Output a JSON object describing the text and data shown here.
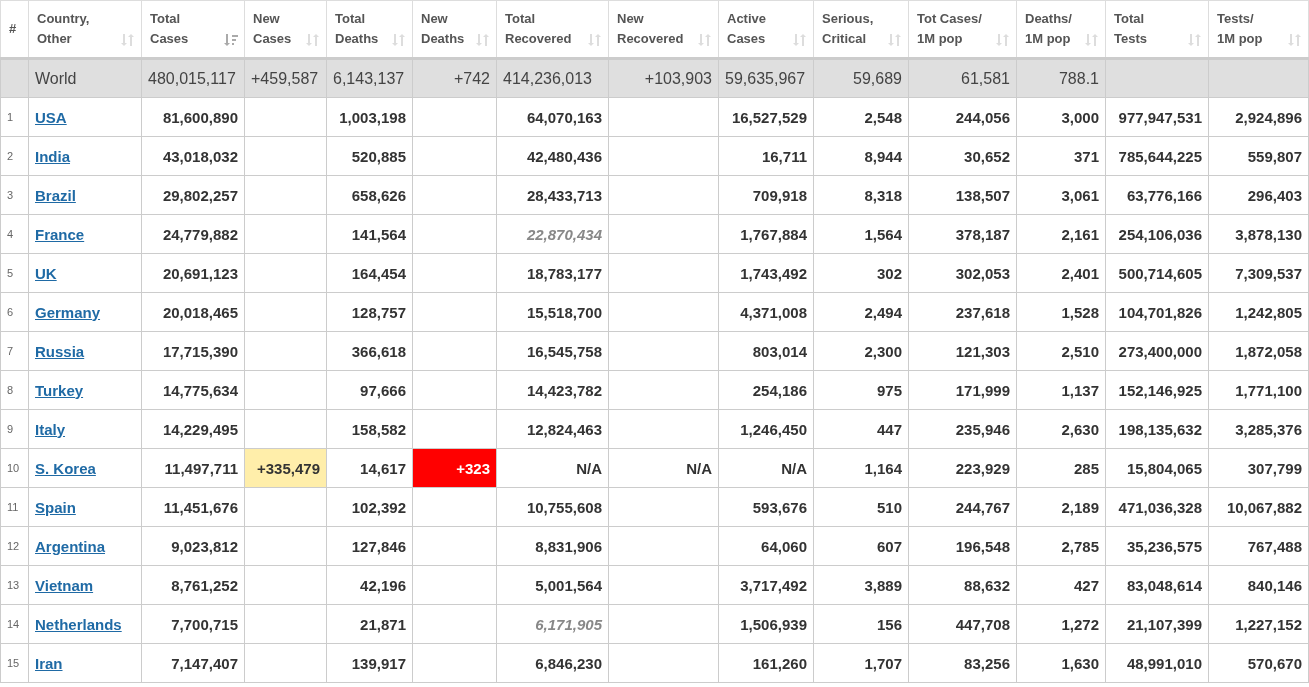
{
  "table": {
    "columns": [
      {
        "label": "#",
        "kind": "rank"
      },
      {
        "label": "Country,\nOther",
        "kind": "country",
        "sorted": false
      },
      {
        "label": "Total\nCases",
        "kind": "number",
        "sorted": true
      },
      {
        "label": "New\nCases",
        "kind": "new_cases",
        "sorted": false
      },
      {
        "label": "Total\nDeaths",
        "kind": "number",
        "sorted": false
      },
      {
        "label": "New\nDeaths",
        "kind": "new_deaths",
        "sorted": false
      },
      {
        "label": "Total\nRecovered",
        "kind": "recovered",
        "sorted": false
      },
      {
        "label": "New\nRecovered",
        "kind": "new_recovered",
        "sorted": false
      },
      {
        "label": "Active\nCases",
        "kind": "number",
        "sorted": false
      },
      {
        "label": "Serious,\nCritical",
        "kind": "number",
        "sorted": false
      },
      {
        "label": "Tot Cases/\n1M pop",
        "kind": "number",
        "sorted": false
      },
      {
        "label": "Deaths/\n1M pop",
        "kind": "number",
        "sorted": false
      },
      {
        "label": "Total\nTests",
        "kind": "number",
        "sorted": false
      },
      {
        "label": "Tests/\n1M pop",
        "kind": "number",
        "sorted": false
      }
    ],
    "rows": [
      {
        "kind": "world",
        "estimated_recovered": false,
        "cells": [
          null,
          "World",
          "480,015,117",
          "+459,587",
          "6,143,137",
          "+742",
          "414,236,013",
          "+103,903",
          "59,635,967",
          "59,689",
          "61,581",
          "788.1",
          null,
          null
        ]
      },
      {
        "kind": "country",
        "estimated_recovered": false,
        "cells": [
          "1",
          "USA",
          "81,600,890",
          null,
          "1,003,198",
          null,
          "64,070,163",
          null,
          "16,527,529",
          "2,548",
          "244,056",
          "3,000",
          "977,947,531",
          "2,924,896"
        ]
      },
      {
        "kind": "country",
        "estimated_recovered": false,
        "cells": [
          "2",
          "India",
          "43,018,032",
          null,
          "520,885",
          null,
          "42,480,436",
          null,
          "16,711",
          "8,944",
          "30,652",
          "371",
          "785,644,225",
          "559,807"
        ]
      },
      {
        "kind": "country",
        "estimated_recovered": false,
        "cells": [
          "3",
          "Brazil",
          "29,802,257",
          null,
          "658,626",
          null,
          "28,433,713",
          null,
          "709,918",
          "8,318",
          "138,507",
          "3,061",
          "63,776,166",
          "296,403"
        ]
      },
      {
        "kind": "country",
        "estimated_recovered": true,
        "cells": [
          "4",
          "France",
          "24,779,882",
          null,
          "141,564",
          null,
          "22,870,434",
          null,
          "1,767,884",
          "1,564",
          "378,187",
          "2,161",
          "254,106,036",
          "3,878,130"
        ]
      },
      {
        "kind": "country",
        "estimated_recovered": false,
        "cells": [
          "5",
          "UK",
          "20,691,123",
          null,
          "164,454",
          null,
          "18,783,177",
          null,
          "1,743,492",
          "302",
          "302,053",
          "2,401",
          "500,714,605",
          "7,309,537"
        ]
      },
      {
        "kind": "country",
        "estimated_recovered": false,
        "cells": [
          "6",
          "Germany",
          "20,018,465",
          null,
          "128,757",
          null,
          "15,518,700",
          null,
          "4,371,008",
          "2,494",
          "237,618",
          "1,528",
          "104,701,826",
          "1,242,805"
        ]
      },
      {
        "kind": "country",
        "estimated_recovered": false,
        "cells": [
          "7",
          "Russia",
          "17,715,390",
          null,
          "366,618",
          null,
          "16,545,758",
          null,
          "803,014",
          "2,300",
          "121,303",
          "2,510",
          "273,400,000",
          "1,872,058"
        ]
      },
      {
        "kind": "country",
        "estimated_recovered": false,
        "cells": [
          "8",
          "Turkey",
          "14,775,634",
          null,
          "97,666",
          null,
          "14,423,782",
          null,
          "254,186",
          "975",
          "171,999",
          "1,137",
          "152,146,925",
          "1,771,100"
        ]
      },
      {
        "kind": "country",
        "estimated_recovered": false,
        "cells": [
          "9",
          "Italy",
          "14,229,495",
          null,
          "158,582",
          null,
          "12,824,463",
          null,
          "1,246,450",
          "447",
          "235,946",
          "2,630",
          "198,135,632",
          "3,285,376"
        ]
      },
      {
        "kind": "country",
        "estimated_recovered": false,
        "cells": [
          "10",
          "S. Korea",
          "11,497,711",
          "+335,479",
          "14,617",
          "+323",
          "N/A",
          "N/A",
          "N/A",
          "1,164",
          "223,929",
          "285",
          "15,804,065",
          "307,799"
        ]
      },
      {
        "kind": "country",
        "estimated_recovered": false,
        "cells": [
          "11",
          "Spain",
          "11,451,676",
          null,
          "102,392",
          null,
          "10,755,608",
          null,
          "593,676",
          "510",
          "244,767",
          "2,189",
          "471,036,328",
          "10,067,882"
        ]
      },
      {
        "kind": "country",
        "estimated_recovered": false,
        "cells": [
          "12",
          "Argentina",
          "9,023,812",
          null,
          "127,846",
          null,
          "8,831,906",
          null,
          "64,060",
          "607",
          "196,548",
          "2,785",
          "35,236,575",
          "767,488"
        ]
      },
      {
        "kind": "country",
        "estimated_recovered": false,
        "cells": [
          "13",
          "Vietnam",
          "8,761,252",
          null,
          "42,196",
          null,
          "5,001,564",
          null,
          "3,717,492",
          "3,889",
          "88,632",
          "427",
          "83,048,614",
          "840,146"
        ]
      },
      {
        "kind": "country",
        "estimated_recovered": true,
        "cells": [
          "14",
          "Netherlands",
          "7,700,715",
          null,
          "21,871",
          null,
          "6,171,905",
          null,
          "1,506,939",
          "156",
          "447,708",
          "1,272",
          "21,107,399",
          "1,227,152"
        ]
      },
      {
        "kind": "country",
        "estimated_recovered": false,
        "cells": [
          "15",
          "Iran",
          "7,147,407",
          null,
          "139,917",
          null,
          "6,846,230",
          null,
          "161,260",
          "1,707",
          "83,256",
          "1,630",
          "48,991,010",
          "570,670"
        ]
      }
    ]
  }
}
